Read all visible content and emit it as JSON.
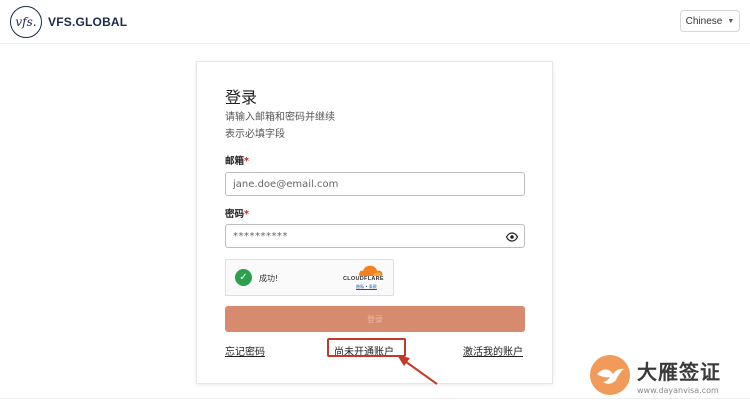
{
  "header": {
    "logo_mark": "vfs.",
    "brand": "VFS.GLOBAL",
    "language": "Chinese"
  },
  "login": {
    "title": "登录",
    "subtitle": "请输入邮箱和密码并继续",
    "required_note": "表示必填字段",
    "email_label": "邮箱",
    "email_placeholder": "jane.doe@email.com",
    "password_label": "密码",
    "password_value": "**********",
    "required_marker": "*",
    "captcha": {
      "status": "成功!",
      "provider": "CLOUDFLARE",
      "links": "隐私 • 条款"
    },
    "submit_label": "登录",
    "forgot_password": "忘记密码",
    "create_account": "尚未开通账户",
    "activate_account": "激活我的账户"
  },
  "watermark": {
    "name": "大雁签证",
    "url": "www.dayanvisa.com"
  },
  "colors": {
    "brand_navy": "#1c2a4a",
    "button": "#d78b6e",
    "highlight": "#c33a2a",
    "success": "#2e9e4f"
  }
}
